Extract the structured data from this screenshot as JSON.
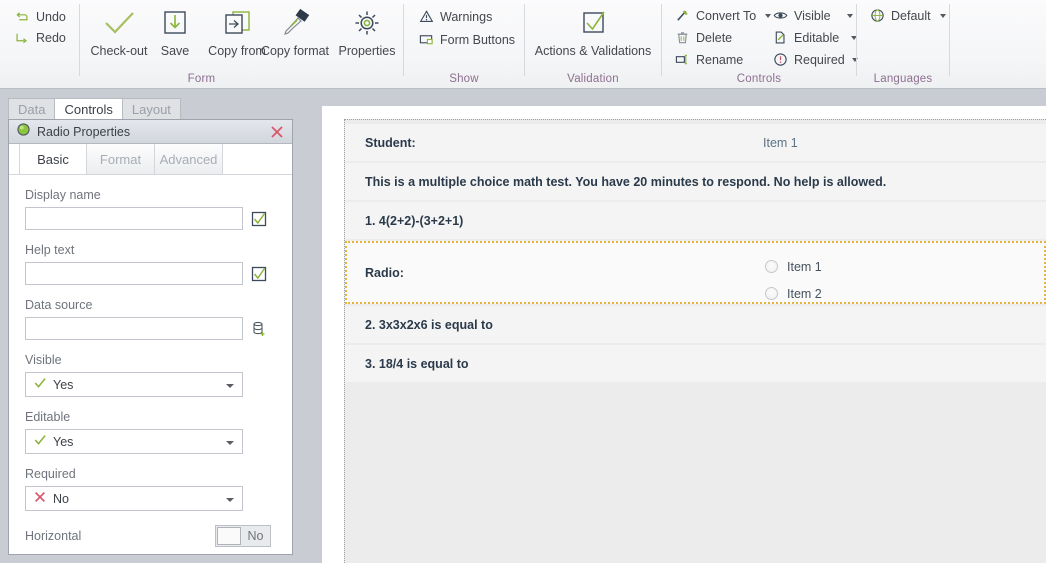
{
  "ribbon": {
    "groups": [
      {
        "name": "Form",
        "label": "Form",
        "quick_commands": [
          {
            "label": "Undo",
            "icon": "undo-icon"
          },
          {
            "label": "Redo",
            "icon": "redo-icon"
          }
        ],
        "buttons": [
          {
            "label": "Check-out",
            "icon": "checkmark-icon"
          },
          {
            "label": "Save",
            "icon": "save-download-icon"
          },
          {
            "label": "Copy from",
            "icon": "copy-from-icon"
          },
          {
            "label": "Copy format",
            "icon": "paintbrush-icon"
          },
          {
            "label": "Properties",
            "icon": "gear-icon"
          }
        ]
      },
      {
        "name": "Show",
        "label": "Show",
        "buttons": [
          {
            "label": "Warnings",
            "icon": "warning-triangle-icon"
          },
          {
            "label": "Form Buttons",
            "icon": "form-buttons-icon"
          }
        ]
      },
      {
        "name": "Validation",
        "label": "Validation",
        "buttons": [
          {
            "label": "Actions & Validations",
            "icon": "checkbox-check-icon"
          }
        ]
      },
      {
        "name": "Controls",
        "label": "Controls",
        "buttons": [
          {
            "label": "Convert To",
            "icon": "convert-to-icon",
            "caret": true
          },
          {
            "label": "Delete",
            "icon": "trash-icon",
            "caret": false
          },
          {
            "label": "Rename",
            "icon": "rename-icon",
            "caret": false
          },
          {
            "label": "Visible",
            "icon": "eye-icon",
            "caret": true
          },
          {
            "label": "Editable",
            "icon": "edit-page-icon",
            "caret": true
          },
          {
            "label": "Required",
            "icon": "exclamation-circle-icon",
            "caret": true
          }
        ]
      },
      {
        "name": "Languages",
        "label": "Languages",
        "buttons": [
          {
            "label": "Default",
            "icon": "globe-icon",
            "caret": true
          }
        ]
      }
    ]
  },
  "left_panel": {
    "tabs": [
      {
        "label": "Data",
        "active": false
      },
      {
        "label": "Controls",
        "active": true
      },
      {
        "label": "Layout",
        "active": false
      }
    ],
    "properties": {
      "title": "Radio Properties",
      "title_icon": "radio-circle-icon",
      "close_icon": "close-icon",
      "subtabs": [
        {
          "label": "Basic",
          "active": true
        },
        {
          "label": "Format",
          "active": false
        },
        {
          "label": "Advanced",
          "active": false
        }
      ],
      "fields": [
        {
          "label": "Display name",
          "type": "text",
          "value": "",
          "adorn_icon": "checkbox-check-icon"
        },
        {
          "label": "Help text",
          "type": "text",
          "value": "",
          "adorn_icon": "checkbox-check-icon"
        },
        {
          "label": "Data source",
          "type": "text",
          "value": "",
          "adorn_icon": "database-add-icon"
        },
        {
          "label": "Visible",
          "type": "select",
          "value": "Yes",
          "value_icon": "green-check-icon"
        },
        {
          "label": "Editable",
          "type": "select",
          "value": "Yes",
          "value_icon": "green-check-icon"
        },
        {
          "label": "Required",
          "type": "select",
          "value": "No",
          "value_icon": "red-x-icon"
        },
        {
          "label": "Horizontal",
          "type": "toggle",
          "value": "No"
        }
      ]
    }
  },
  "canvas": {
    "rows": [
      {
        "kind": "field",
        "label": "Student:",
        "value": "Item 1",
        "selected": false
      },
      {
        "kind": "text",
        "label": "This is a multiple choice math test. You have 20 minutes to respond. No help is allowed.",
        "selected": false
      },
      {
        "kind": "text",
        "label": "1. 4(2+2)-(3+2+1)",
        "selected": false
      },
      {
        "kind": "radio",
        "label": "Radio:",
        "selected": true,
        "options": [
          "Item 1",
          "Item 2"
        ]
      },
      {
        "kind": "text",
        "label": "2. 3x3x2x6 is equal to",
        "selected": false
      },
      {
        "kind": "text",
        "label": "3. 18/4 is equal to",
        "selected": false
      }
    ]
  },
  "colors": {
    "accent_green": "#8cb43c",
    "selection_gold": "#e8b33c",
    "group_label": "#8d6f8f",
    "text_dark": "#2b3a4a",
    "red_x": "#d95b6a"
  }
}
